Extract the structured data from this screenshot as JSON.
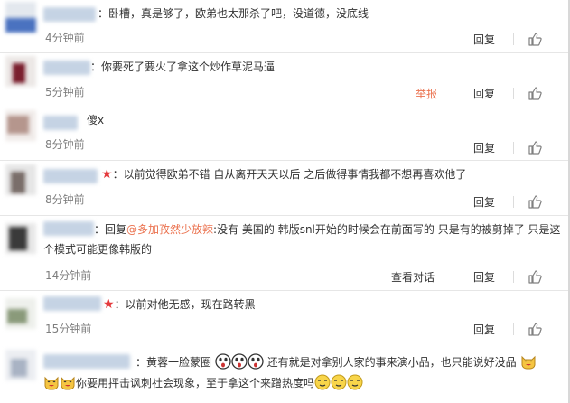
{
  "comments": [
    {
      "text": "：卧槽，真是够了，欧弟也太那杀了吧，没道德，没底线",
      "time": "4分钟前",
      "reply": "回复"
    },
    {
      "text": "：你要死了要火了拿这个炒作草泥马逼",
      "time": "5分钟前",
      "report": "举报",
      "reply": "回复"
    },
    {
      "text": "傻x",
      "time": "8分钟前",
      "reply": "回复"
    },
    {
      "star": "★",
      "text": "：以前觉得欧弟不错 自从离开天天以后 之后做得事情我都不想再喜欢他了",
      "time": "8分钟前",
      "reply": "回复"
    },
    {
      "prefix": "：回复",
      "link": "@多加孜然少放辣",
      "text": ":没有 美国的 韩版snl开始的时候会在前面写的 只是有的被剪掉了 只是这",
      "text2": "个模式可能更像韩版的",
      "time": "14分钟前",
      "view": "查看对话",
      "reply": "回复"
    },
    {
      "star": "★",
      "text": "：以前对他无感，现在路转黑",
      "time": "15分钟前",
      "reply": "回复"
    },
    {
      "text": "：黄蓉一脸蒙圈",
      "text_mid": "还有就是对拿别人家的事来演小品，也只能说好没品",
      "text2": "你要用抨击讽刺社会现象，至于拿这个来蹭热度吗"
    }
  ],
  "icons": {
    "like": "thumbs-up-icon",
    "laugh": "laughing-cat-emoji",
    "shock": "shocked-face-emoji",
    "smirk": "smirk-face-emoji"
  },
  "colors": {
    "link": "#eb7350",
    "star": "#e4393c",
    "time": "#7f7f7f",
    "divider": "#e6e6e6"
  }
}
